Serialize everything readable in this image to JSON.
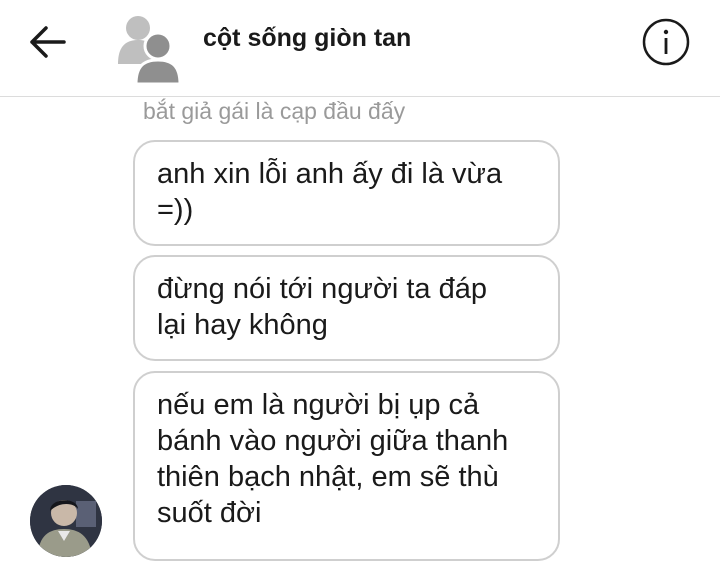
{
  "header": {
    "title": "cột sống giòn tan",
    "back_icon": "arrow-left-icon",
    "group_avatar_icon": "group-avatar-icon",
    "info_icon": "info-icon"
  },
  "thread": {
    "sender_name": "bắt giả gái là cạp đầu đấy",
    "messages": [
      {
        "text": "anh xin lỗi anh ấy đi là vừa\n=))"
      },
      {
        "text": "đừng nói tới người ta đáp\nlại hay không"
      },
      {
        "text": "nếu em là người bị ụp cả\nbánh vào người giữa thanh\nthiên bạch nhật, em sẽ thù\nsuốt đời"
      }
    ]
  },
  "colors": {
    "bubble_border": "#cfcfcf",
    "sender_name": "#9a9a9a",
    "icon": "#1a1a1a"
  }
}
